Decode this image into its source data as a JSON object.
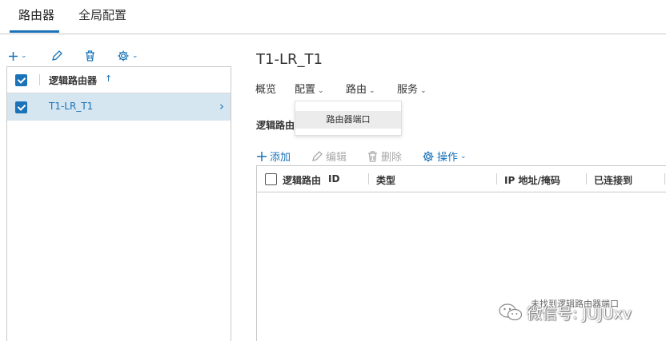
{
  "tabs": [
    {
      "label": "路由器",
      "active": true
    },
    {
      "label": "全局配置",
      "active": false
    }
  ],
  "left_panel": {
    "toolbar_icons": [
      "plus-icon",
      "edit-icon",
      "trash-icon",
      "gear-icon"
    ],
    "column_header": "逻辑路由器",
    "sort": "ascending",
    "rows": [
      {
        "label": "T1-LR_T1",
        "selected": true
      }
    ]
  },
  "detail": {
    "title": "T1-LR_T1",
    "subnav": [
      {
        "label": "概览",
        "has_menu": false
      },
      {
        "label": "配置",
        "has_menu": true
      },
      {
        "label": "路由",
        "has_menu": true
      },
      {
        "label": "服务",
        "has_menu": true
      }
    ],
    "dropdown_items": [
      "路由器端口"
    ],
    "section_title": "逻辑路由",
    "actions": [
      {
        "label": "添加",
        "icon": "plus-icon",
        "enabled": true
      },
      {
        "label": "编辑",
        "icon": "pencil-icon",
        "enabled": false
      },
      {
        "label": "删除",
        "icon": "trash-icon",
        "enabled": false
      },
      {
        "label": "操作",
        "icon": "gear-icon",
        "enabled": true
      }
    ],
    "grid": {
      "columns": [
        "逻辑路由",
        "ID",
        "类型",
        "IP 地址/掩码",
        "已连接到"
      ],
      "empty_message": "未找到逻辑路由器端口"
    }
  },
  "watermark": {
    "text": "微信号: JUJUxv",
    "icon": "wechat-icon"
  },
  "colors": {
    "accent": "#1a73b8",
    "selected_row": "#d5e6f0",
    "border": "#c9c9c9"
  }
}
